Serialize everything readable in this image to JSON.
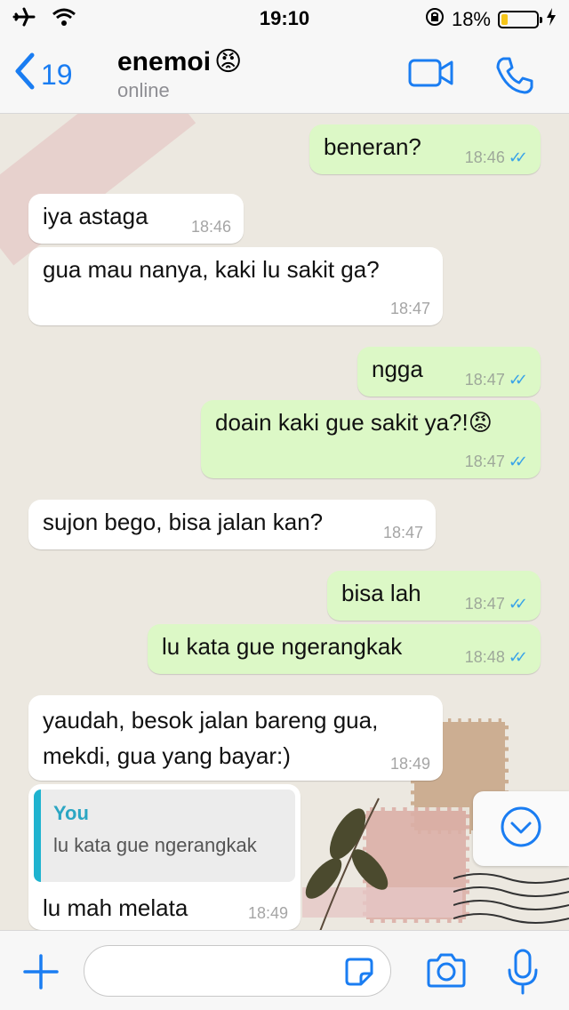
{
  "status_bar": {
    "time": "19:10",
    "battery_percent": "18%",
    "battery_level": 0.18
  },
  "header": {
    "back_count": "19",
    "contact_name": "enemoi",
    "contact_emoji": "😡",
    "contact_status": "online"
  },
  "messages": [
    {
      "direction": "out",
      "text": "beneran?",
      "time": "18:46"
    },
    {
      "direction": "in",
      "text": "iya astaga",
      "time": "18:46"
    },
    {
      "direction": "in",
      "text": "gua mau nanya, kaki lu sakit ga?",
      "time": "18:47"
    },
    {
      "direction": "out",
      "text": "ngga",
      "time": "18:47"
    },
    {
      "direction": "out",
      "text": "doain kaki gue sakit ya?!",
      "emoji": "😡",
      "time": "18:47"
    },
    {
      "direction": "in",
      "text": "sujon bego, bisa jalan kan?",
      "time": "18:47"
    },
    {
      "direction": "out",
      "text": "bisa lah",
      "time": "18:47"
    },
    {
      "direction": "out",
      "text": "lu kata gue ngerangkak",
      "time": "18:48"
    },
    {
      "direction": "in",
      "text_line1": "yaudah, besok jalan bareng gua,",
      "text_line2": "mekdi, gua yang bayar:)",
      "time": "18:49"
    },
    {
      "direction": "in",
      "reply_author": "You",
      "reply_text": "lu kata gue ngerangkak",
      "text": "lu mah melata",
      "time": "18:49"
    }
  ],
  "colors": {
    "accent": "#1a7df2",
    "outgoing_bubble": "#dcf8c6",
    "incoming_bubble": "#ffffff",
    "read_ticks": "#39a3e8",
    "reply_bar": "#1fb3cf"
  },
  "icons": [
    "airplane-icon",
    "wifi-icon",
    "rotation-lock-icon",
    "charging-icon",
    "back-chevron-icon",
    "video-call-icon",
    "phone-icon",
    "scroll-down-icon",
    "plus-icon",
    "sticker-icon",
    "camera-icon",
    "microphone-icon"
  ]
}
